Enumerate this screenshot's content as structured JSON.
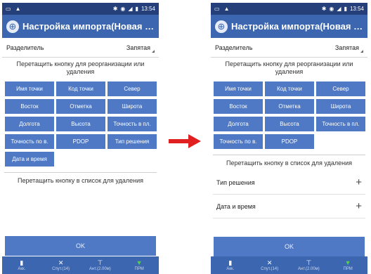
{
  "colors": {
    "status_bar": "#243f7a",
    "title_bar": "#3c67b0",
    "button": "#4f79c4",
    "arrow": "#e02020"
  },
  "status": {
    "time": "13:54"
  },
  "header": {
    "title": "Настройка импорта(Новая ра..."
  },
  "delimiter": {
    "label": "Разделитель",
    "value": "Запятая"
  },
  "reorder_hint": "Перетащить кнопку для реорганизации или удаления",
  "before": {
    "fields": [
      "Имя точки",
      "Код точки",
      "Север",
      "Восток",
      "Отметка",
      "Широта",
      "Долгота",
      "Высота",
      "Точность в пл.",
      "Точность по в.",
      "PDOP",
      "Тип решения",
      "Дата и время"
    ],
    "delete_hint": "Перетащить кнопку в список для удаления"
  },
  "after": {
    "fields": [
      "Имя точки",
      "Код точки",
      "Север",
      "Восток",
      "Отметка",
      "Широта",
      "Долгота",
      "Высота",
      "Точность в пл.",
      "Точность по в.",
      "PDOP"
    ],
    "delete_hint": "Перетащить кнопку в список для удаления",
    "removed": [
      "Тип решения",
      "Дата и время"
    ],
    "add_symbol": "+"
  },
  "ok_label": "OK",
  "bottom_bar": [
    {
      "icon": "battery-icon",
      "label": "Акк."
    },
    {
      "icon": "satellite-icon",
      "label": "Спут.(14)"
    },
    {
      "icon": "antenna-icon",
      "label": "Ант.(2.00м)"
    },
    {
      "icon": "wifi-icon",
      "label": "ПРМ"
    }
  ]
}
